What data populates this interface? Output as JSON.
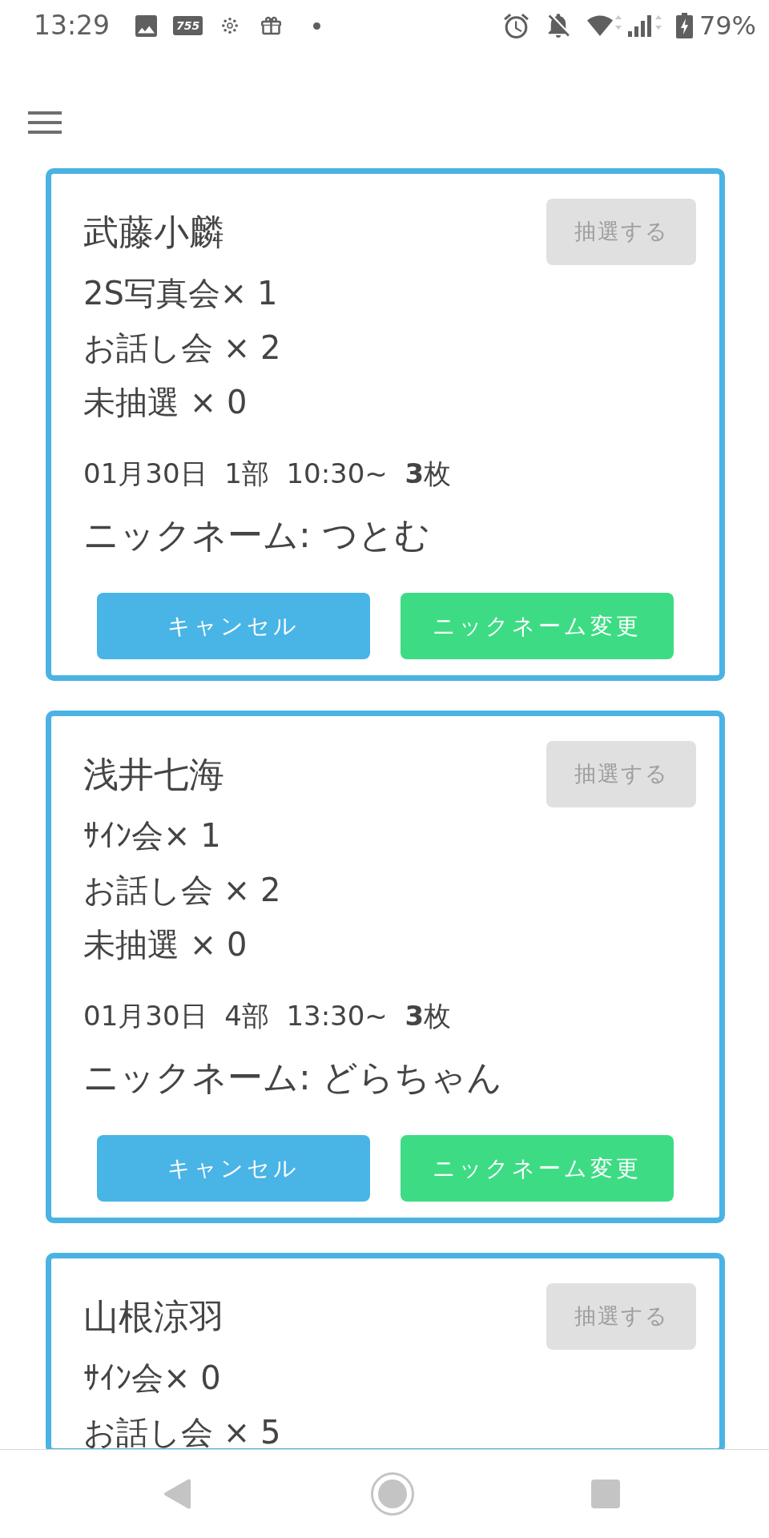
{
  "status_bar": {
    "time": "13:29",
    "app_logo": "755",
    "battery": "79%"
  },
  "cards": [
    {
      "name": "武藤小麟",
      "draw_button": {
        "label": "抽選する",
        "disabled": true
      },
      "items": [
        "2S写真会× 1",
        "お話し会 × 2",
        "未抽選 × 0"
      ],
      "schedule": "01月30日  1部  10:30~  **3**枚",
      "nickname": "ニックネーム: つとむ",
      "buttons": [
        {
          "label": "キャンセル",
          "kind": "cancel"
        },
        {
          "label": "ニックネーム変更",
          "kind": "rename"
        }
      ]
    },
    {
      "name": "浅井七海",
      "draw_button": {
        "label": "抽選する",
        "disabled": true
      },
      "items": [
        "ｻｲﾝ会× 1",
        "お話し会 × 2",
        "未抽選 × 0"
      ],
      "schedule": "01月30日  4部  13:30~  **3**枚",
      "nickname": "ニックネーム: どらちゃん",
      "buttons": [
        {
          "label": "キャンセル",
          "kind": "cancel"
        },
        {
          "label": "ニックネーム変更",
          "kind": "rename"
        }
      ]
    },
    {
      "name": "山根涼羽",
      "draw_button": {
        "label": "抽選する",
        "disabled": true
      },
      "items": [
        "ｻｲﾝ会× 0",
        "お話し会 × 5"
      ]
    }
  ]
}
